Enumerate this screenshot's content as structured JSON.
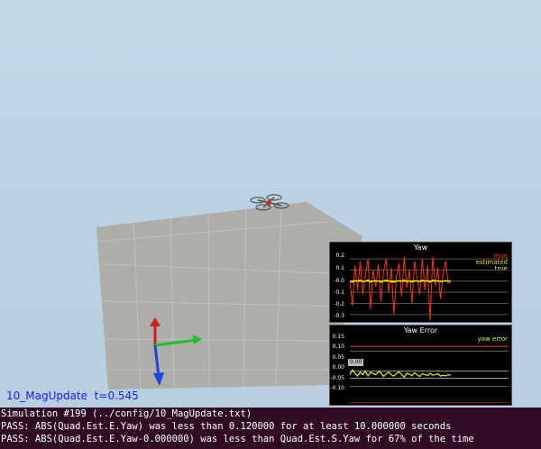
{
  "sim": {
    "scenario_label": "10_MagUpdate  t=0.545"
  },
  "yaw_plot": {
    "title": "Yaw",
    "y_ticks": [
      "0.2",
      "0.1",
      "-0.0",
      "-0.1",
      "-0.2",
      "-0.3"
    ],
    "legend": [
      "mag",
      "estimated",
      "true"
    ],
    "colors": {
      "mag": "#ff3300",
      "estimated": "#ffd800",
      "true": "#e8ff00"
    }
  },
  "yaw_error_plot": {
    "title": "Yaw Error",
    "y_ticks": [
      "0.15",
      "0.10",
      "0.05",
      "0.00",
      "-0.05",
      "-0.10"
    ],
    "legend": [
      "yaw error"
    ],
    "value_badge": "0.00",
    "colors": {
      "yaw_error": "#d4ff00",
      "threshold": "#ff3333"
    }
  },
  "chart_data": [
    {
      "type": "line",
      "title": "Yaw",
      "ylim": [
        -0.35,
        0.25
      ],
      "series": [
        {
          "name": "mag",
          "values": [
            0.0,
            -0.22,
            0.14,
            -0.08,
            0.18,
            -0.12,
            0.05,
            0.2,
            -0.25,
            0.1,
            -0.05,
            0.15,
            -0.18,
            0.08,
            0.2,
            -0.1,
            0.12,
            -0.3,
            0.04,
            0.16,
            -0.14,
            0.22,
            -0.06,
            0.1,
            -0.2,
            0.18,
            0.02,
            -0.12,
            0.2,
            -0.08,
            0.14,
            -0.35,
            0.22,
            -0.04,
            0.12,
            -0.16,
            0.06,
            0.18,
            -0.02,
            0.0
          ]
        },
        {
          "name": "estimated",
          "values": [
            0.0,
            -0.01,
            0.005,
            0.0,
            0.01,
            -0.005,
            0.0,
            0.01,
            -0.01,
            0.0,
            0.005,
            0.0,
            -0.01,
            0.0,
            0.01,
            0.0,
            -0.005,
            -0.01,
            0.0,
            0.005,
            0.0,
            0.01,
            -0.005,
            0.0,
            -0.01,
            0.005,
            0.0,
            -0.005,
            0.01,
            0.0,
            0.005,
            -0.01,
            0.01,
            0.0,
            0.005,
            -0.005,
            0.0,
            0.005,
            0.0,
            0.0
          ]
        },
        {
          "name": "true",
          "values": [
            0.0,
            0.0,
            0.0,
            0.0,
            0.0,
            0.0,
            0.0,
            0.0,
            0.0,
            0.0,
            0.0,
            0.0,
            0.0,
            0.0,
            0.0,
            0.0,
            0.0,
            0.0,
            0.0,
            0.0,
            0.0,
            0.0,
            0.0,
            0.0,
            0.0,
            0.0,
            0.0,
            0.0,
            0.0,
            0.0,
            0.0,
            0.0,
            0.0,
            0.0,
            0.0,
            0.0,
            0.0,
            0.0,
            0.0,
            0.0
          ]
        }
      ]
    },
    {
      "type": "line",
      "title": "Yaw Error",
      "ylim": [
        -0.12,
        0.17
      ],
      "thresholds": [
        0.12,
        -0.12
      ],
      "series": [
        {
          "name": "yaw error",
          "values": [
            0.0,
            0.02,
            0.005,
            -0.005,
            0.01,
            0.0,
            0.015,
            -0.005,
            0.01,
            0.005,
            0.0,
            0.012,
            0.008,
            -0.008,
            0.003,
            0.01,
            0.0,
            -0.006,
            0.005,
            0.012,
            0.0,
            -0.01,
            0.006,
            0.002,
            -0.004,
            0.008,
            0.0,
            -0.008,
            0.004,
            0.0,
            -0.004,
            0.006,
            -0.002,
            0.0,
            0.004,
            -0.006,
            -0.003,
            -0.005,
            0.0,
            -0.002
          ]
        }
      ]
    }
  ],
  "console": {
    "lines": [
      "Simulation #199 (../config/10_MagUpdate.txt)",
      "PASS: ABS(Quad.Est.E.Yaw) was less than 0.120000 for at least 10.000000 seconds",
      "PASS: ABS(Quad.Est.E.Yaw-0.000000) was less than Quad.Est.S.Yaw for 67% of the time"
    ]
  }
}
